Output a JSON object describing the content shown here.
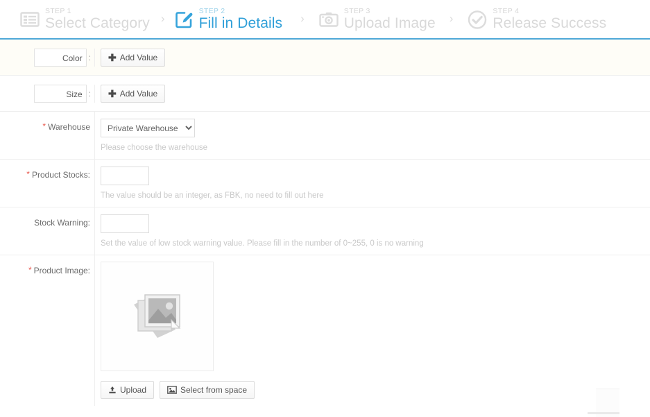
{
  "steps": {
    "items": [
      {
        "num": "STEP 1",
        "name": "Select Category",
        "icon": "list-icon",
        "active": false
      },
      {
        "num": "STEP 2",
        "name": "Fill in Details",
        "icon": "edit-pencil-icon",
        "active": true
      },
      {
        "num": "STEP 3",
        "name": "Upload Image",
        "icon": "camera-icon",
        "active": false
      },
      {
        "num": "STEP 4",
        "name": "Release Success",
        "icon": "check-circle-icon",
        "active": false
      }
    ],
    "separator": "›",
    "active_color": "#2f9fd8",
    "inactive_color": "#d9d9d9",
    "underline_color": "#4fa8d8"
  },
  "form": {
    "required_mark": "*",
    "colon": ":",
    "attributes": [
      {
        "name": "Color",
        "add_label": "Add Value",
        "add_icon": "plus-icon"
      },
      {
        "name": "Size",
        "add_label": "Add Value",
        "add_icon": "plus-icon"
      }
    ],
    "warehouse": {
      "label": "Warehouse",
      "required": true,
      "selected": "Private Warehouse",
      "options": [
        "Private Warehouse"
      ],
      "hint": "Please choose the warehouse"
    },
    "product_stocks": {
      "label": "Product Stocks:",
      "required": true,
      "value": "",
      "hint": "The value should be an integer, as FBK, no need to fill out here"
    },
    "stock_warning": {
      "label": "Stock Warning:",
      "required": false,
      "value": "",
      "hint": "Set the value of low stock warning value. Please fill in the number of 0~255, 0 is no warning"
    },
    "product_image": {
      "label": "Product Image:",
      "required": true,
      "placeholder_icon": "photo-stack-icon",
      "upload_button": {
        "label": "Upload",
        "icon": "upload-icon"
      },
      "space_button": {
        "label": "Select from space",
        "icon": "picture-icon"
      }
    }
  }
}
